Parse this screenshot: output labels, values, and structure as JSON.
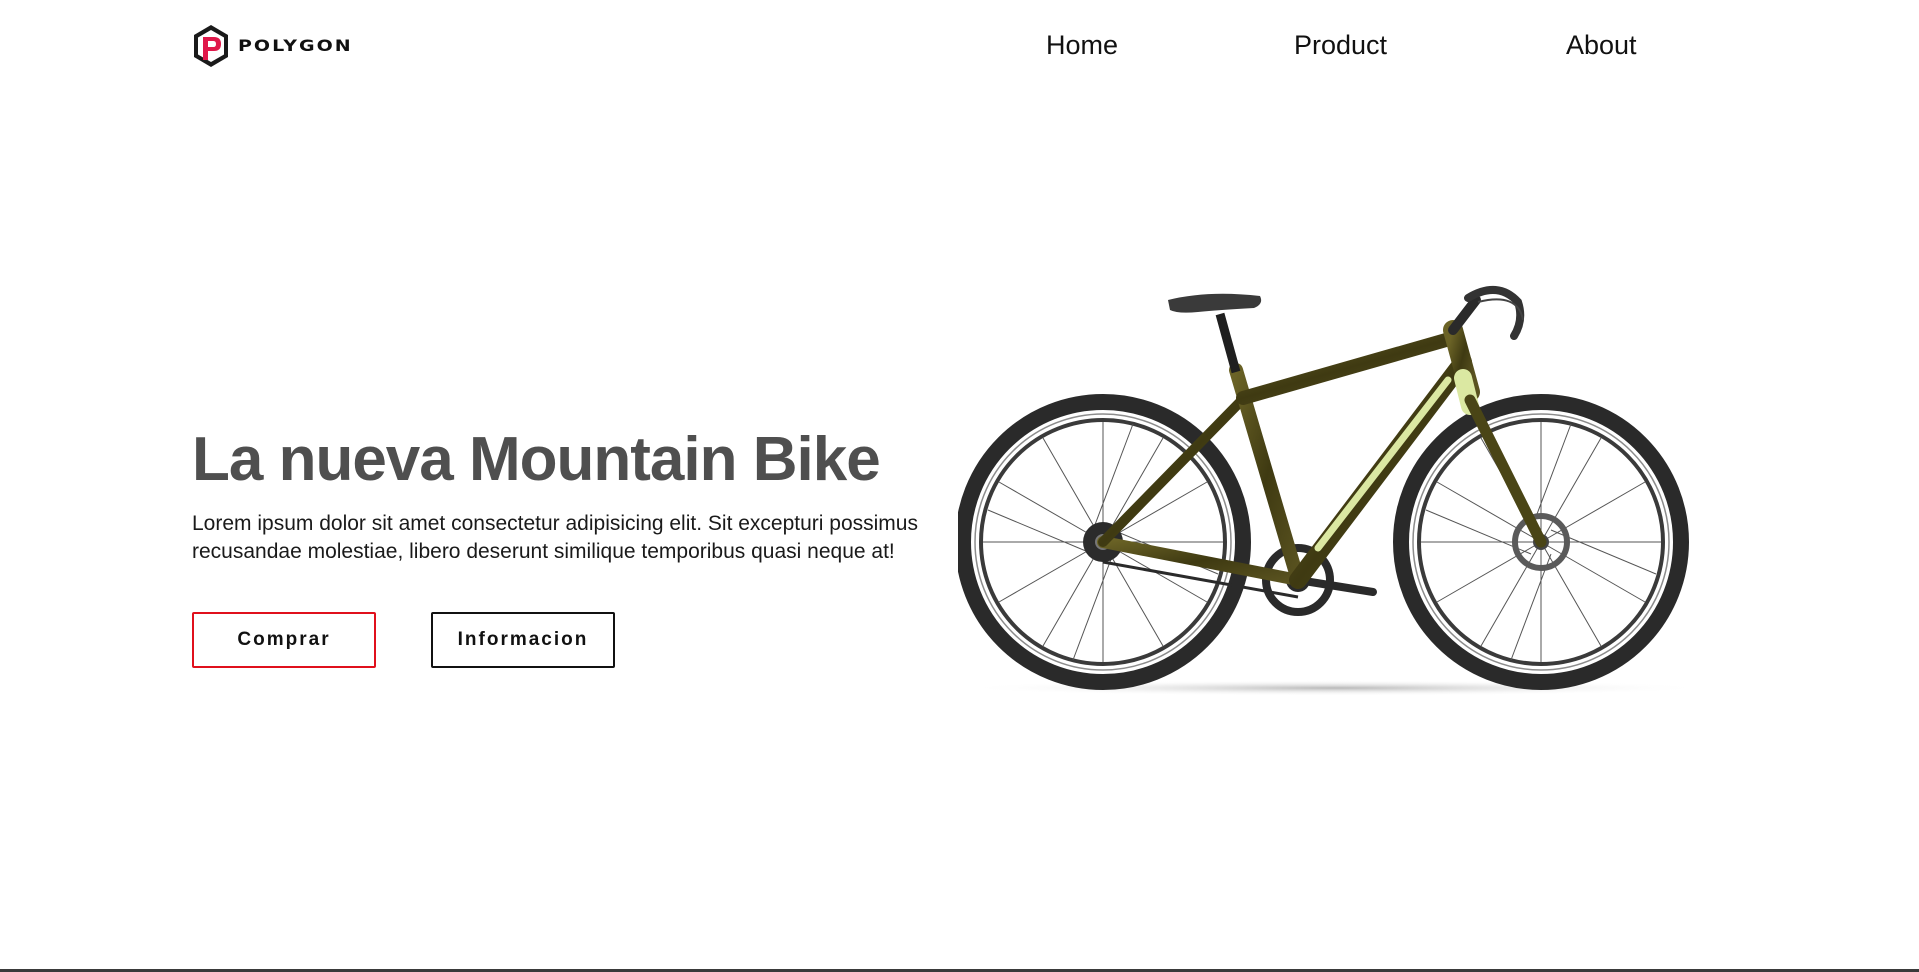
{
  "brand": {
    "name": "POLYGON",
    "logo_icon": "polygon-hexagon-logo",
    "logo_color": "#e0184a"
  },
  "nav": {
    "items": [
      {
        "label": "Home"
      },
      {
        "label": "Product"
      },
      {
        "label": "About"
      }
    ]
  },
  "hero": {
    "title": "La nueva Mountain Bike",
    "description": "Lorem ipsum dolor sit amet consectetur adipisicing elit. Sit excepturi possimus recusandae molestiae, libero deserunt similique temporibus quasi neque at!",
    "primary_button": "Comprar",
    "secondary_button": "Informacion",
    "image": "bicycle-image"
  },
  "colors": {
    "accent": "#e0101c",
    "title": "#4f4f4f",
    "text": "#1a1a1a",
    "bike_frame": "#4f4a18",
    "bike_accent": "#dbe8a2"
  }
}
